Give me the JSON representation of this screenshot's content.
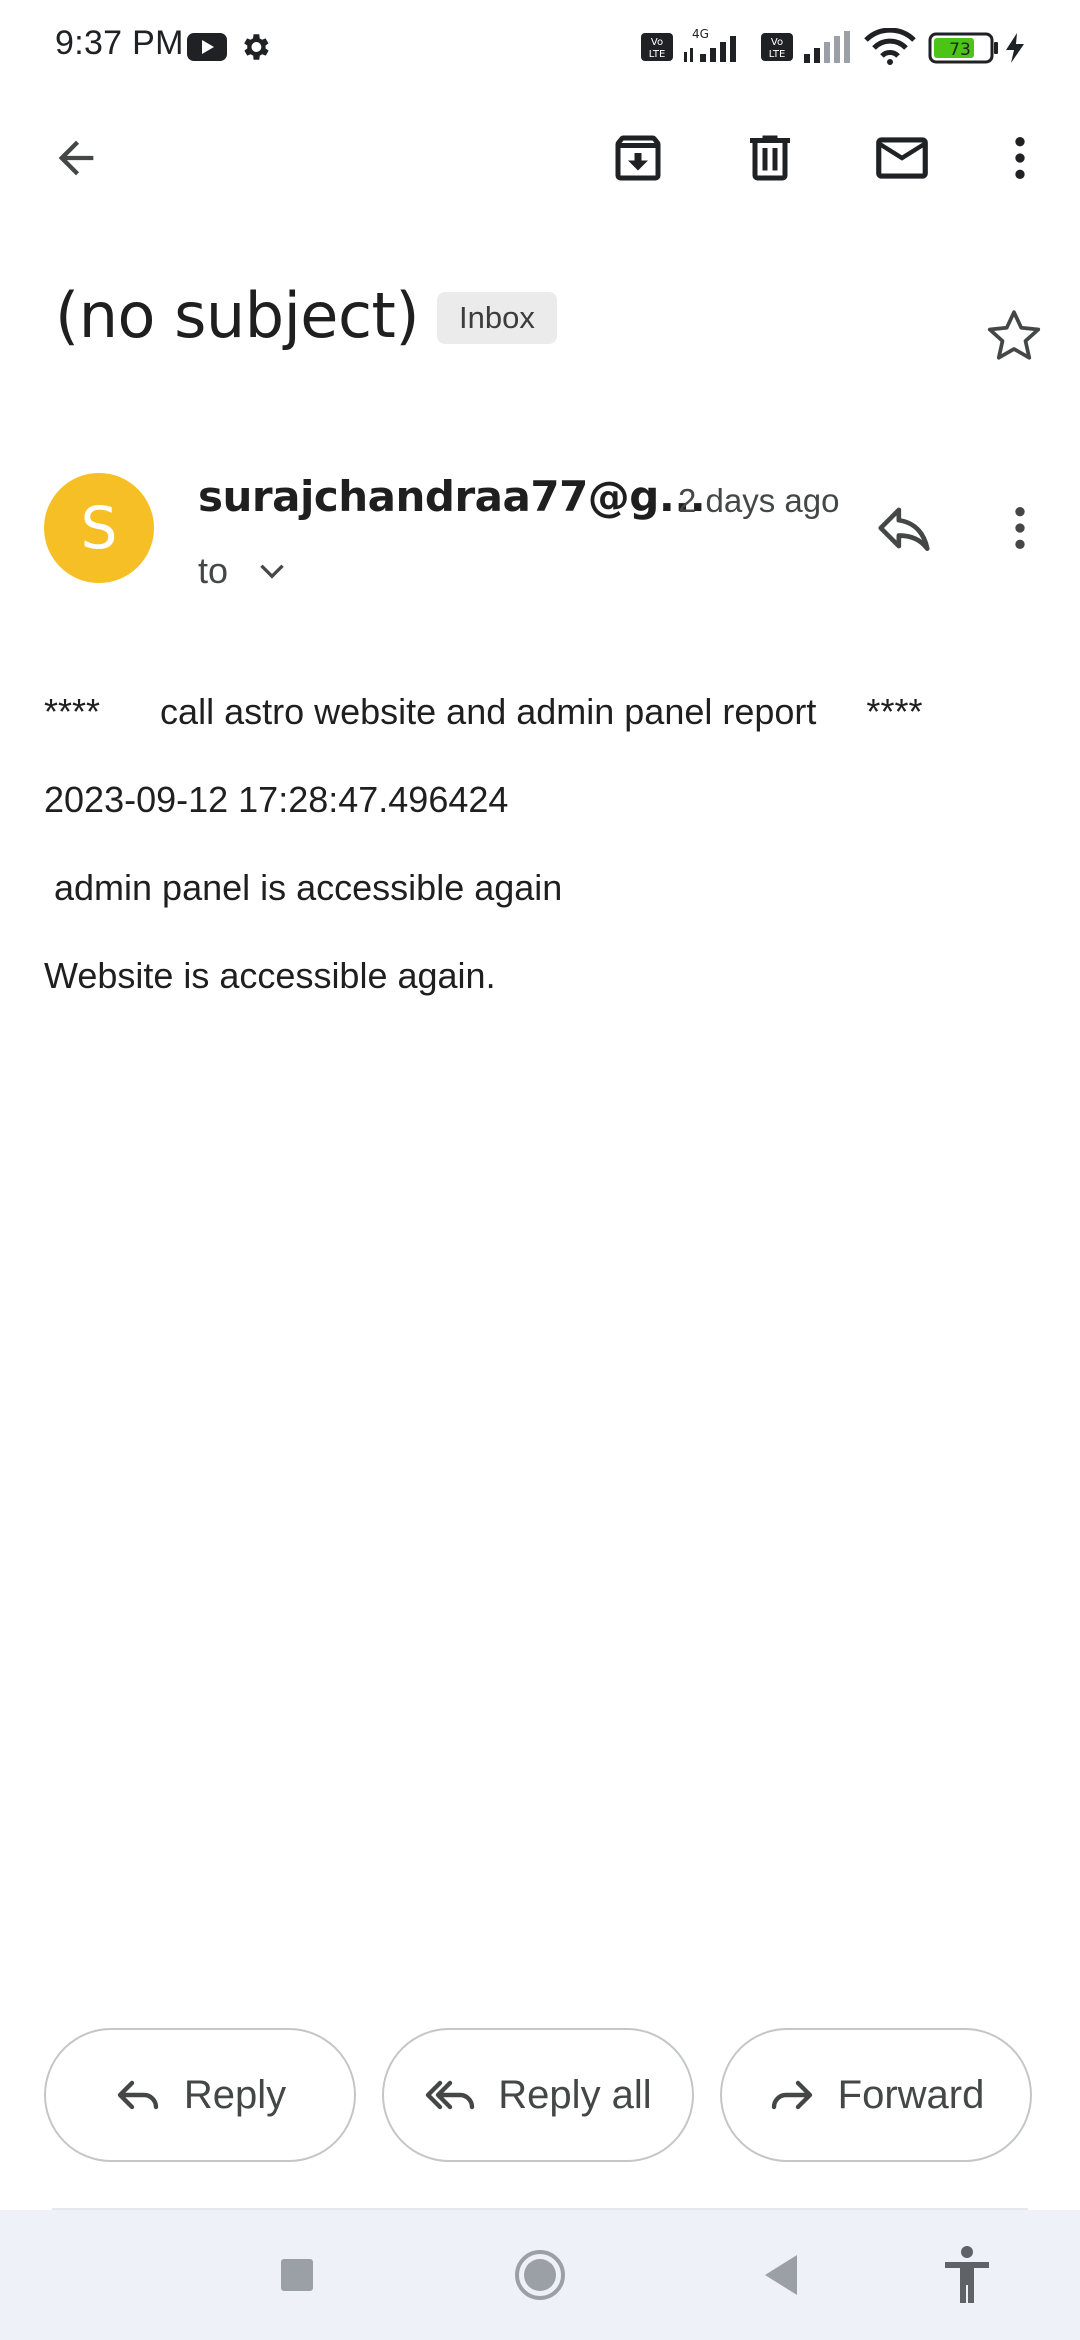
{
  "status_bar": {
    "time": "9:37 PM",
    "battery_level": "73",
    "icons": [
      "youtube-icon",
      "settings-icon",
      "volte-icon",
      "signal-4g-icon",
      "volte-icon",
      "signal-icon",
      "wifi-icon",
      "battery-icon",
      "charging-icon"
    ]
  },
  "app_bar": {
    "icons": [
      "back-arrow-icon",
      "archive-icon",
      "delete-icon",
      "mark-unread-icon",
      "more-vert-icon"
    ]
  },
  "email": {
    "subject": "(no subject)",
    "label": "Inbox",
    "starred": false,
    "sender": "surajchandraa77@g...",
    "avatar_initial": "S",
    "avatar_color": "#f6bf26",
    "time": "2 days ago",
    "to": "to",
    "body": [
      "****      call astro website and admin panel report     ****",
      "2023-09-12 17:28:47.496424",
      " admin panel is accessible again",
      "Website is accessible again."
    ]
  },
  "actions": {
    "reply": "Reply",
    "reply_all": "Reply all",
    "forward": "Forward"
  },
  "nav_bar": {
    "icons": [
      "recents-square-icon",
      "home-circle-icon",
      "back-triangle-icon",
      "accessibility-icon"
    ]
  },
  "colors": {
    "battery_fill": "#4cc417",
    "nav_bg": "#eef1f8"
  }
}
